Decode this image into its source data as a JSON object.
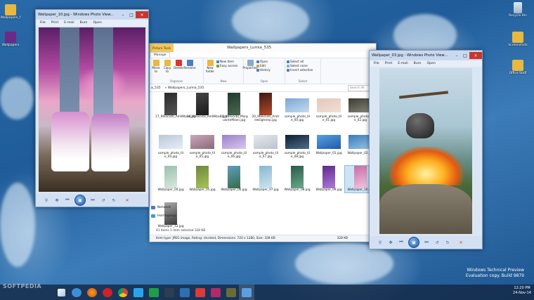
{
  "desktop": {
    "icons_left": [
      {
        "label": "Wallpapers_f"
      },
      {
        "label": "Wallpapers"
      }
    ],
    "icons_right": [
      {
        "label": "Recycle Bin"
      },
      {
        "label": "Screenshots"
      },
      {
        "label": "Office Staff"
      }
    ],
    "watermark_line1": "Windows Technical Preview",
    "watermark_line2": "Evaluation copy. Build 9879",
    "softpedia": "SOFTPEDIA"
  },
  "viewer_left": {
    "title": "Wallpaper_10.jpg - Windows Photo View...",
    "menu": [
      "File",
      "Print",
      "E-mail",
      "Burn",
      "Open"
    ]
  },
  "viewer_right": {
    "title": "Wallpaper_03.jpg - Windows Photo View...",
    "menu": [
      "File",
      "Print",
      "E-mail",
      "Burn",
      "Open"
    ]
  },
  "explorer": {
    "tools_tab": "Picture Tools",
    "title": "Wallpapers_Lumia_535",
    "tabs": [
      "Manage"
    ],
    "ribbon": {
      "organize": {
        "label": "Organize",
        "buttons": [
          "Move to",
          "Copy to",
          "Delete",
          "Rename"
        ]
      },
      "new": {
        "label": "New",
        "buttons": [
          "New folder"
        ],
        "small": [
          "New item",
          "Easy access"
        ]
      },
      "open": {
        "label": "Open",
        "buttons": [
          "Properties"
        ],
        "small": [
          "Open",
          "Edit",
          "History"
        ]
      },
      "select": {
        "label": "Select",
        "small": [
          "Select all",
          "Select none",
          "Invert selection"
        ]
      }
    },
    "address": "«  Wallpapers_Lumia_535",
    "address_prefix": "a_535",
    "search_placeholder": "Search W",
    "files": [
      {
        "name": "17_960x540_AmWiboo.jpg"
      },
      {
        "name": "18_960x540_AmWiboo.jpg"
      },
      {
        "name": "19_960x540_Marg uanteMoon.jpg"
      },
      {
        "name": "20_960x540_Andr ewGgterep.jpg"
      },
      {
        "name": "sample_photo_til e_00.jpg"
      },
      {
        "name": "sample_photo_til e_01.jpg"
      },
      {
        "name": "sample_photo_til e_02.jpg"
      },
      {
        "name": "sample_photo_til e_04.jpg"
      },
      {
        "name": "sample_photo_til e_05.jpg"
      },
      {
        "name": "sample_photo_til e_06.jpg"
      },
      {
        "name": "sample_photo_til e_07.jpg"
      },
      {
        "name": "sample_photo_til e_08.jpg"
      },
      {
        "name": "Wallpaper_01.jpg"
      },
      {
        "name": "Wallpaper_02.jpg"
      },
      {
        "name": "Wallpaper_04.jpg"
      },
      {
        "name": "Wallpaper_05.jpg"
      },
      {
        "name": "Wallpaper_06.jpg"
      },
      {
        "name": "Wallpaper_07.jpg"
      },
      {
        "name": "Wallpaper_08.jpg"
      },
      {
        "name": "Wallpaper_09.jpg"
      },
      {
        "name": "Wallpaper_10.jpg"
      },
      {
        "name": "Wallpaper_12.jpg"
      }
    ],
    "nav": [
      "Network",
      "Homegroup"
    ],
    "status": "41 items    1 item selected  328 KB",
    "details_left": "Item type: JPEG image, Rating: Unrated, Dimensions: 720 x 1280, Size: 328 KB",
    "details_right": "328 KB"
  },
  "taskbar": {
    "clock_time": "12:20 PM",
    "clock_date": "24-Nov-14"
  }
}
